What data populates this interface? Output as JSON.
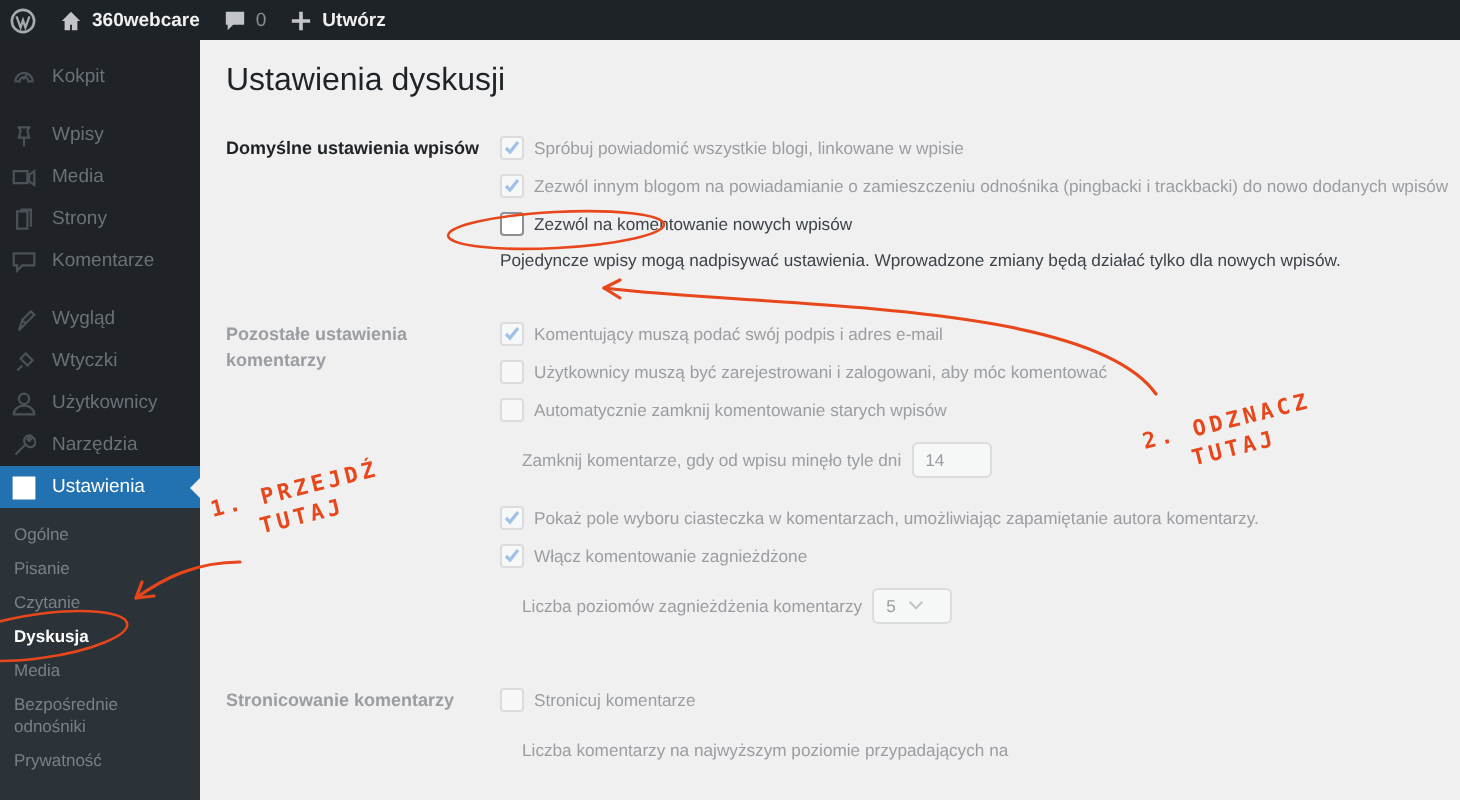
{
  "admin_bar": {
    "site": "360webcare",
    "comments": "0",
    "new": "Utwórz"
  },
  "sidebar": {
    "groups": [
      [
        {
          "label": "Kokpit",
          "selected": false,
          "dimmed": true
        }
      ],
      [
        {
          "label": "Wpisy",
          "selected": false,
          "dimmed": true
        },
        {
          "label": "Media",
          "selected": false,
          "dimmed": true
        },
        {
          "label": "Strony",
          "selected": false,
          "dimmed": true
        },
        {
          "label": "Komentarze",
          "selected": false,
          "dimmed": true
        }
      ],
      [
        {
          "label": "Wygląd",
          "selected": false,
          "dimmed": true
        },
        {
          "label": "Wtyczki",
          "selected": false,
          "dimmed": true
        },
        {
          "label": "Użytkownicy",
          "selected": false,
          "dimmed": true
        },
        {
          "label": "Narzędzia",
          "selected": false,
          "dimmed": true
        },
        {
          "label": "Ustawienia",
          "selected": true,
          "dimmed": false
        }
      ]
    ],
    "submenu": [
      {
        "label": "Ogólne",
        "selected": false,
        "dimmed": true
      },
      {
        "label": "Pisanie",
        "selected": false,
        "dimmed": true
      },
      {
        "label": "Czytanie",
        "selected": false,
        "dimmed": true
      },
      {
        "label": "Dyskusja",
        "selected": true,
        "dimmed": false
      },
      {
        "label": "Media",
        "selected": false,
        "dimmed": true
      },
      {
        "label": "Bezpośrednie odnośniki",
        "selected": false,
        "dimmed": true
      },
      {
        "label": "Prywatność",
        "selected": false,
        "dimmed": true
      }
    ]
  },
  "page_title": "Ustawienia dyskusji",
  "sections": [
    {
      "label": "Domyślne ustawienia wpisów",
      "dimmed": false,
      "options": [
        {
          "kind": "checkbox",
          "label": "Spróbuj powiadomić wszystkie blogi, linkowane w wpisie",
          "checked": true,
          "dimmed": true
        },
        {
          "kind": "checkbox",
          "label": "Zezwól innym blogom na powiadamianie o zamieszczeniu odnośnika (pingbacki i trackbacki) do nowo dodanych wpisów",
          "checked": true,
          "dimmed": true
        },
        {
          "kind": "checkbox",
          "label": "Zezwól na komentowanie nowych wpisów",
          "checked": false,
          "dimmed": false
        },
        {
          "kind": "note",
          "label": "Pojedyncze wpisy mogą nadpisywać ustawienia. Wprowadzone zmiany będą działać tylko dla nowych wpisów.",
          "dimmed": false
        }
      ]
    },
    {
      "label": "Pozostałe ustawienia komentarzy",
      "dimmed": true,
      "options": [
        {
          "kind": "checkbox",
          "label": "Komentujący muszą podać swój podpis i adres e-mail",
          "checked": true,
          "dimmed": true
        },
        {
          "kind": "checkbox",
          "label": "Użytkownicy muszą być zarejestrowani i zalogowani, aby móc komentować",
          "checked": false,
          "dimmed": true
        },
        {
          "kind": "checkbox",
          "label": "Automatycznie zamknij komentowanie starych wpisów",
          "checked": false,
          "dimmed": true
        },
        {
          "kind": "number",
          "label": "Zamknij komentarze, gdy od wpisu minęło tyle dni",
          "value": "14",
          "dimmed": true
        },
        {
          "kind": "checkbox",
          "label": "Pokaż pole wyboru ciasteczka w komentarzach, umożliwiając zapamiętanie autora komentarzy.",
          "checked": true,
          "dimmed": true
        },
        {
          "kind": "checkbox",
          "label": "Włącz komentowanie zagnieżdżone",
          "checked": true,
          "dimmed": true
        },
        {
          "kind": "select",
          "label": "Liczba poziomów zagnieżdżenia komentarzy",
          "value": "5",
          "dimmed": true
        }
      ]
    },
    {
      "label": "Stronicowanie komentarzy",
      "dimmed": true,
      "options": [
        {
          "kind": "checkbox",
          "label": "Stronicuj komentarze",
          "checked": false,
          "dimmed": true
        },
        {
          "kind": "text",
          "label": "Liczba komentarzy na najwyższym poziomie przypadających na",
          "dimmed": true
        }
      ]
    }
  ],
  "annotations": [
    {
      "lines": [
        "1. PRZEJDŹ",
        "TUTAJ"
      ]
    },
    {
      "lines": [
        "2. ODZNACZ",
        "TUTAJ"
      ]
    }
  ]
}
